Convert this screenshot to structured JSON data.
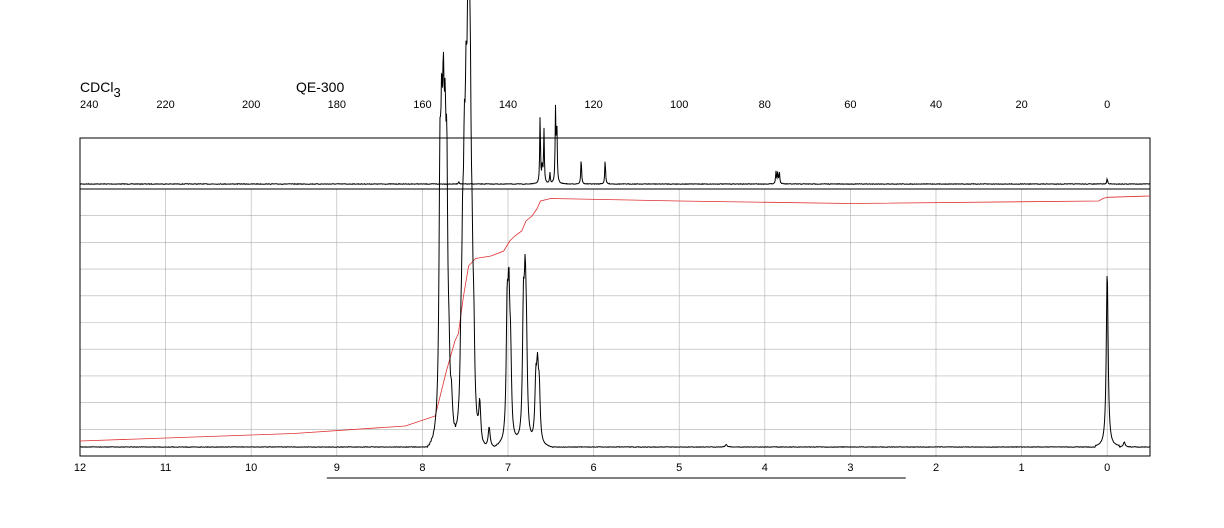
{
  "header": {
    "solvent": "CDCl",
    "solvent_sub": "3",
    "instrument": "QE-300"
  },
  "colors": {
    "spectrum": "#000000",
    "integral": "#e03030",
    "grid": "#b0b0b0",
    "frame": "#000000"
  },
  "chart_data": [
    {
      "type": "line",
      "id": "c13",
      "nucleus": "13C",
      "xlim": [
        240,
        -10
      ],
      "ticks": [
        240,
        220,
        200,
        180,
        160,
        140,
        120,
        100,
        80,
        60,
        40,
        20,
        0
      ],
      "tick_labels": [
        "240",
        "220",
        "200",
        "180",
        "160",
        "140",
        "120",
        "100",
        "80",
        "60",
        "40",
        "20",
        "0"
      ],
      "ylim": [
        0,
        1
      ],
      "grid": false,
      "peaks": [
        {
          "x": 151.5,
          "y": 0.04
        },
        {
          "x": 132.5,
          "y": 0.95
        },
        {
          "x": 132.0,
          "y": 0.26
        },
        {
          "x": 131.6,
          "y": 0.76
        },
        {
          "x": 130.2,
          "y": 0.15
        },
        {
          "x": 128.9,
          "y": 1.0
        },
        {
          "x": 128.6,
          "y": 0.88
        },
        {
          "x": 122.9,
          "y": 0.37
        },
        {
          "x": 117.3,
          "y": 0.35
        },
        {
          "x": 77.4,
          "y": 0.17
        },
        {
          "x": 77.0,
          "y": 0.17
        },
        {
          "x": 76.6,
          "y": 0.17
        },
        {
          "x": 0.0,
          "y": 0.08
        }
      ]
    },
    {
      "type": "line",
      "id": "h1",
      "nucleus": "1H",
      "xlim": [
        12,
        -0.5
      ],
      "ticks": [
        12,
        11,
        10,
        9,
        8,
        7,
        6,
        5,
        4,
        3,
        2,
        1,
        0
      ],
      "tick_labels": [
        "12",
        "11",
        "10",
        "9",
        "8",
        "7",
        "6",
        "5",
        "4",
        "3",
        "2",
        "1",
        "0"
      ],
      "ylim": [
        0,
        1
      ],
      "grid": true,
      "peaks": [
        {
          "x": 7.795,
          "y": 0.9
        },
        {
          "x": 7.775,
          "y": 0.85
        },
        {
          "x": 7.755,
          "y": 0.92
        },
        {
          "x": 7.735,
          "y": 0.8
        },
        {
          "x": 7.715,
          "y": 0.87
        },
        {
          "x": 7.69,
          "y": 0.22
        },
        {
          "x": 7.66,
          "y": 0.12
        },
        {
          "x": 7.55,
          "y": 0.25
        },
        {
          "x": 7.53,
          "y": 0.55
        },
        {
          "x": 7.51,
          "y": 0.75
        },
        {
          "x": 7.49,
          "y": 0.88
        },
        {
          "x": 7.47,
          "y": 0.92
        },
        {
          "x": 7.455,
          "y": 0.97
        },
        {
          "x": 7.44,
          "y": 0.85
        },
        {
          "x": 7.42,
          "y": 0.45
        },
        {
          "x": 7.4,
          "y": 0.3
        },
        {
          "x": 7.33,
          "y": 0.15
        },
        {
          "x": 7.22,
          "y": 0.08
        },
        {
          "x": 7.01,
          "y": 0.48
        },
        {
          "x": 6.99,
          "y": 0.5
        },
        {
          "x": 6.97,
          "y": 0.3
        },
        {
          "x": 6.82,
          "y": 0.48
        },
        {
          "x": 6.8,
          "y": 0.5
        },
        {
          "x": 6.785,
          "y": 0.3
        },
        {
          "x": 6.675,
          "y": 0.22
        },
        {
          "x": 6.655,
          "y": 0.25
        },
        {
          "x": 6.635,
          "y": 0.2
        },
        {
          "x": 4.45,
          "y": 0.01
        },
        {
          "x": 0.0,
          "y": 0.7
        },
        {
          "x": -0.2,
          "y": 0.02
        }
      ],
      "integral": {
        "x": [
          12,
          9.5,
          8.2,
          7.85,
          7.72,
          7.62,
          7.58,
          7.52,
          7.46,
          7.38,
          7.2,
          7.05,
          6.98,
          6.92,
          6.84,
          6.79,
          6.72,
          6.66,
          6.62,
          6.5,
          5.0,
          3.0,
          0.1,
          0.05,
          0.0,
          -0.5
        ],
        "y": [
          0.02,
          0.05,
          0.08,
          0.12,
          0.3,
          0.42,
          0.45,
          0.6,
          0.72,
          0.75,
          0.76,
          0.78,
          0.82,
          0.84,
          0.86,
          0.9,
          0.92,
          0.95,
          0.98,
          0.99,
          0.98,
          0.97,
          0.98,
          0.99,
          0.995,
          1.0
        ]
      },
      "axis_bar": {
        "from": 9.0,
        "to": 2.4
      }
    }
  ]
}
